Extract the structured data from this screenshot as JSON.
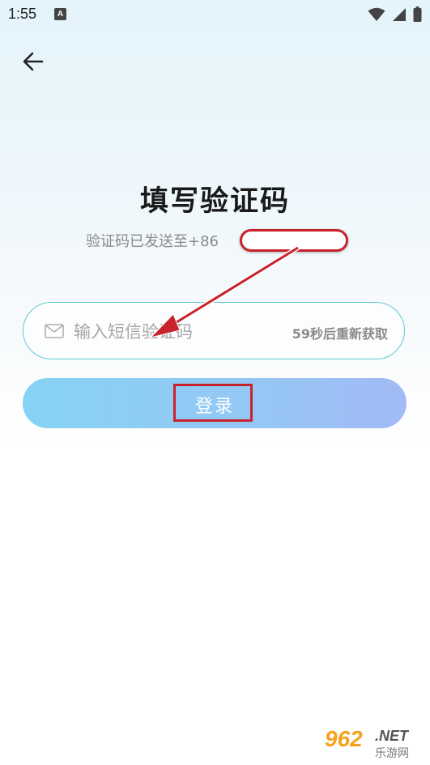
{
  "status_bar": {
    "time": "1:55",
    "notification_letter": "A",
    "icons": [
      "wifi-icon",
      "signal-icon",
      "battery-icon"
    ]
  },
  "nav": {
    "back_icon": "arrow-left-icon"
  },
  "page": {
    "title": "填写验证码",
    "subtitle": "验证码已发送至+86"
  },
  "code_field": {
    "icon": "mail-icon",
    "placeholder": "输入短信验证码",
    "value": "",
    "resend_label": "59秒后重新获取"
  },
  "login_button": {
    "label": "登录"
  },
  "colors": {
    "accent_border": "#5fc8d6",
    "button_gradient_start": "#86d3f4",
    "button_gradient_end": "#a2baf5",
    "annotation_red": "#c8232c"
  },
  "watermark": {
    "number": "962",
    "domain": ".NET",
    "name": "乐游网"
  }
}
